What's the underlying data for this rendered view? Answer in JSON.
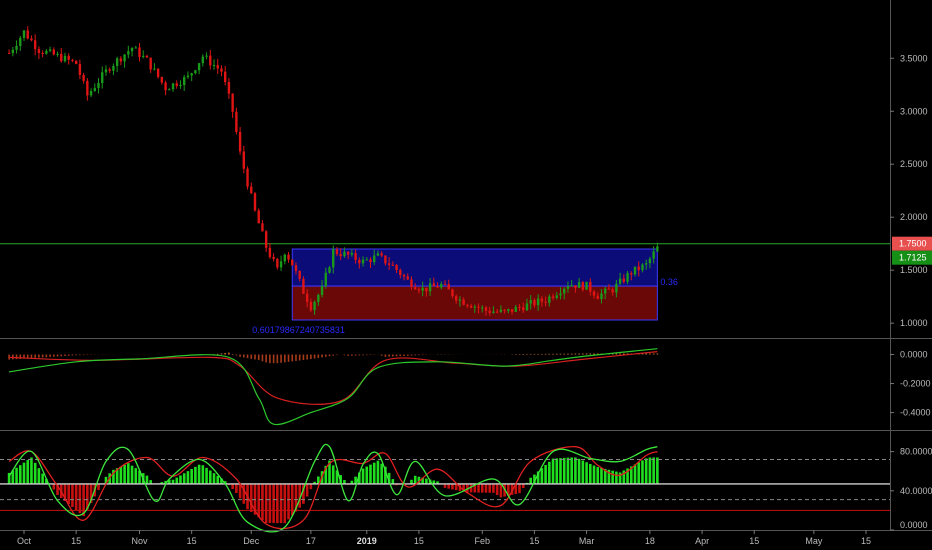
{
  "colors": {
    "background": "#000000",
    "up": "#1a9a1a",
    "down": "#e01414",
    "grid_line": "#6a6a6a",
    "macd_line": "#2cc92c",
    "signal_line": "#d42020",
    "stoch_k": "#3ce83c",
    "stoch_d": "#e02020",
    "hist_up": "#1fe01f",
    "hist_down": "#c81010",
    "level_line": "#2aa52a",
    "box_top": "#0c0c78",
    "box_bottom": "#6a0808",
    "box_border": "#3a3aff",
    "label_red": "#e85050",
    "label_green": "#168f16",
    "axis_text": "#bbbbbb"
  },
  "chart_data": [
    {
      "type": "candlestick",
      "title": "",
      "y_ticks": [
        "3.5000",
        "3.0000",
        "2.5000",
        "2.0000",
        "1.5000",
        "1.0000"
      ],
      "ylim": [
        0.86,
        4.05
      ],
      "horizontal_level": 1.75,
      "last_price_label": "1.7500",
      "current_price_label": "1.7125",
      "box": {
        "x_start": "2018-12-12",
        "x_end": "2019-03-20",
        "top": 1.7,
        "mid": 1.35,
        "bottom": 1.03
      },
      "box_label_left": "0.60179867240735831",
      "box_label_right": "0.36",
      "close_path": [
        [
          "2018-09-27",
          3.55
        ],
        [
          "2018-10-01",
          3.75
        ],
        [
          "2018-10-05",
          3.58
        ],
        [
          "2018-10-10",
          3.52
        ],
        [
          "2018-10-15",
          3.45
        ],
        [
          "2018-10-18",
          3.15
        ],
        [
          "2018-10-24",
          3.42
        ],
        [
          "2018-10-30",
          3.6
        ],
        [
          "2018-11-03",
          3.48
        ],
        [
          "2018-11-08",
          3.22
        ],
        [
          "2018-11-14",
          3.32
        ],
        [
          "2018-11-18",
          3.52
        ],
        [
          "2018-11-23",
          3.38
        ],
        [
          "2018-11-26",
          3.0
        ],
        [
          "2018-11-28",
          2.6
        ],
        [
          "2018-12-02",
          2.05
        ],
        [
          "2018-12-05",
          1.72
        ],
        [
          "2018-12-08",
          1.5
        ],
        [
          "2018-12-10",
          1.68
        ],
        [
          "2018-12-12",
          1.56
        ],
        [
          "2018-12-15",
          1.3
        ],
        [
          "2018-12-17",
          1.16
        ],
        [
          "2018-12-20",
          1.32
        ],
        [
          "2018-12-23",
          1.68
        ],
        [
          "2018-12-27",
          1.64
        ],
        [
          "2018-12-31",
          1.58
        ],
        [
          "2019-01-04",
          1.63
        ],
        [
          "2019-01-08",
          1.54
        ],
        [
          "2019-01-12",
          1.4
        ],
        [
          "2019-01-16",
          1.32
        ],
        [
          "2019-01-21",
          1.36
        ],
        [
          "2019-01-26",
          1.22
        ],
        [
          "2019-02-02",
          1.12
        ],
        [
          "2019-02-07",
          1.1
        ],
        [
          "2019-02-12",
          1.16
        ],
        [
          "2019-02-18",
          1.22
        ],
        [
          "2019-02-24",
          1.37
        ],
        [
          "2019-03-01",
          1.35
        ],
        [
          "2019-03-04",
          1.26
        ],
        [
          "2019-03-08",
          1.32
        ],
        [
          "2019-03-13",
          1.48
        ],
        [
          "2019-03-17",
          1.55
        ],
        [
          "2019-03-20",
          1.71
        ]
      ]
    },
    {
      "type": "line",
      "title": "",
      "y_ticks": [
        "0.0000",
        "-0.2000",
        "-0.4000"
      ],
      "ylim": [
        -0.52,
        0.1
      ],
      "series": [
        {
          "points": [
            [
              "2018-09-27",
              -0.12
            ],
            [
              "2018-10-15",
              -0.05
            ],
            [
              "2018-11-01",
              -0.03
            ],
            [
              "2018-11-25",
              -0.02
            ],
            [
              "2018-12-03",
              -0.3
            ],
            [
              "2018-12-07",
              -0.48
            ],
            [
              "2018-12-17",
              -0.4
            ],
            [
              "2018-12-27",
              -0.3
            ],
            [
              "2019-01-04",
              -0.09
            ],
            [
              "2019-01-20",
              -0.05
            ],
            [
              "2019-02-07",
              -0.08
            ],
            [
              "2019-02-20",
              -0.04
            ],
            [
              "2019-03-01",
              -0.01
            ],
            [
              "2019-03-20",
              0.04
            ]
          ]
        },
        {
          "points": [
            [
              "2018-09-27",
              -0.02
            ],
            [
              "2018-10-20",
              -0.04
            ],
            [
              "2018-11-20",
              -0.02
            ],
            [
              "2018-11-28",
              -0.08
            ],
            [
              "2018-12-08",
              -0.3
            ],
            [
              "2018-12-25",
              -0.32
            ],
            [
              "2019-01-06",
              -0.04
            ],
            [
              "2019-01-25",
              -0.06
            ],
            [
              "2019-02-10",
              -0.08
            ],
            [
              "2019-03-01",
              -0.03
            ],
            [
              "2019-03-20",
              0.02
            ]
          ]
        }
      ]
    },
    {
      "type": "line",
      "title": "",
      "y_ticks": [
        "80.0000",
        "40.0000",
        "0.0000"
      ],
      "ylim": [
        0,
        100
      ],
      "reference_levels": [
        72,
        47,
        31,
        20
      ],
      "series": [
        {
          "points": [
            [
              "2018-09-27",
              55
            ],
            [
              "2018-10-03",
              80
            ],
            [
              "2018-10-10",
              30
            ],
            [
              "2018-10-17",
              17
            ],
            [
              "2018-10-23",
              70
            ],
            [
              "2018-10-29",
              82
            ],
            [
              "2018-11-05",
              30
            ],
            [
              "2018-11-09",
              52
            ],
            [
              "2018-11-17",
              72
            ],
            [
              "2018-11-24",
              47
            ],
            [
              "2018-11-30",
              8
            ],
            [
              "2018-12-10",
              3
            ],
            [
              "2018-12-18",
              70
            ],
            [
              "2018-12-22",
              85
            ],
            [
              "2018-12-27",
              30
            ],
            [
              "2018-12-31",
              67
            ],
            [
              "2019-01-04",
              78
            ],
            [
              "2019-01-09",
              36
            ],
            [
              "2019-01-14",
              70
            ],
            [
              "2019-01-22",
              35
            ],
            [
              "2019-02-04",
              52
            ],
            [
              "2019-02-11",
              26
            ],
            [
              "2019-02-20",
              80
            ],
            [
              "2019-03-02",
              73
            ],
            [
              "2019-03-10",
              70
            ],
            [
              "2019-03-17",
              82
            ],
            [
              "2019-03-20",
              85
            ]
          ]
        },
        {
          "points": [
            [
              "2018-09-27",
              70
            ],
            [
              "2018-10-03",
              80
            ],
            [
              "2018-10-10",
              45
            ],
            [
              "2018-10-17",
              10
            ],
            [
              "2018-10-25",
              58
            ],
            [
              "2018-11-03",
              74
            ],
            [
              "2018-11-10",
              55
            ],
            [
              "2018-11-18",
              74
            ],
            [
              "2018-11-27",
              52
            ],
            [
              "2018-12-05",
              6
            ],
            [
              "2018-12-15",
              10
            ],
            [
              "2018-12-22",
              68
            ],
            [
              "2018-12-31",
              68
            ],
            [
              "2019-01-06",
              78
            ],
            [
              "2019-01-12",
              44
            ],
            [
              "2019-01-20",
              62
            ],
            [
              "2019-01-28",
              38
            ],
            [
              "2019-02-06",
              25
            ],
            [
              "2019-02-14",
              70
            ],
            [
              "2019-02-26",
              85
            ],
            [
              "2019-03-04",
              66
            ],
            [
              "2019-03-10",
              56
            ],
            [
              "2019-03-17",
              76
            ],
            [
              "2019-03-20",
              80
            ]
          ]
        }
      ]
    }
  ],
  "x_axis": {
    "ticks": [
      {
        "date": "2018-10-01",
        "label": "Oct",
        "bold": false
      },
      {
        "date": "2018-10-15",
        "label": "15",
        "bold": false
      },
      {
        "date": "2018-11-01",
        "label": "Nov",
        "bold": false
      },
      {
        "date": "2018-11-15",
        "label": "15",
        "bold": false
      },
      {
        "date": "2018-12-01",
        "label": "Dec",
        "bold": false
      },
      {
        "date": "2018-12-17",
        "label": "17",
        "bold": false
      },
      {
        "date": "2019-01-01",
        "label": "2019",
        "bold": true
      },
      {
        "date": "2019-01-15",
        "label": "15",
        "bold": false
      },
      {
        "date": "2019-02-01",
        "label": "Feb",
        "bold": false
      },
      {
        "date": "2019-02-15",
        "label": "15",
        "bold": false
      },
      {
        "date": "2019-03-01",
        "label": "Mar",
        "bold": false
      },
      {
        "date": "2019-03-18",
        "label": "18",
        "bold": false
      },
      {
        "date": "2019-04-01",
        "label": "Apr",
        "bold": false
      },
      {
        "date": "2019-04-15",
        "label": "15",
        "bold": false
      },
      {
        "date": "2019-05-01",
        "label": "May",
        "bold": false
      },
      {
        "date": "2019-05-15",
        "label": "15",
        "bold": false
      }
    ]
  }
}
